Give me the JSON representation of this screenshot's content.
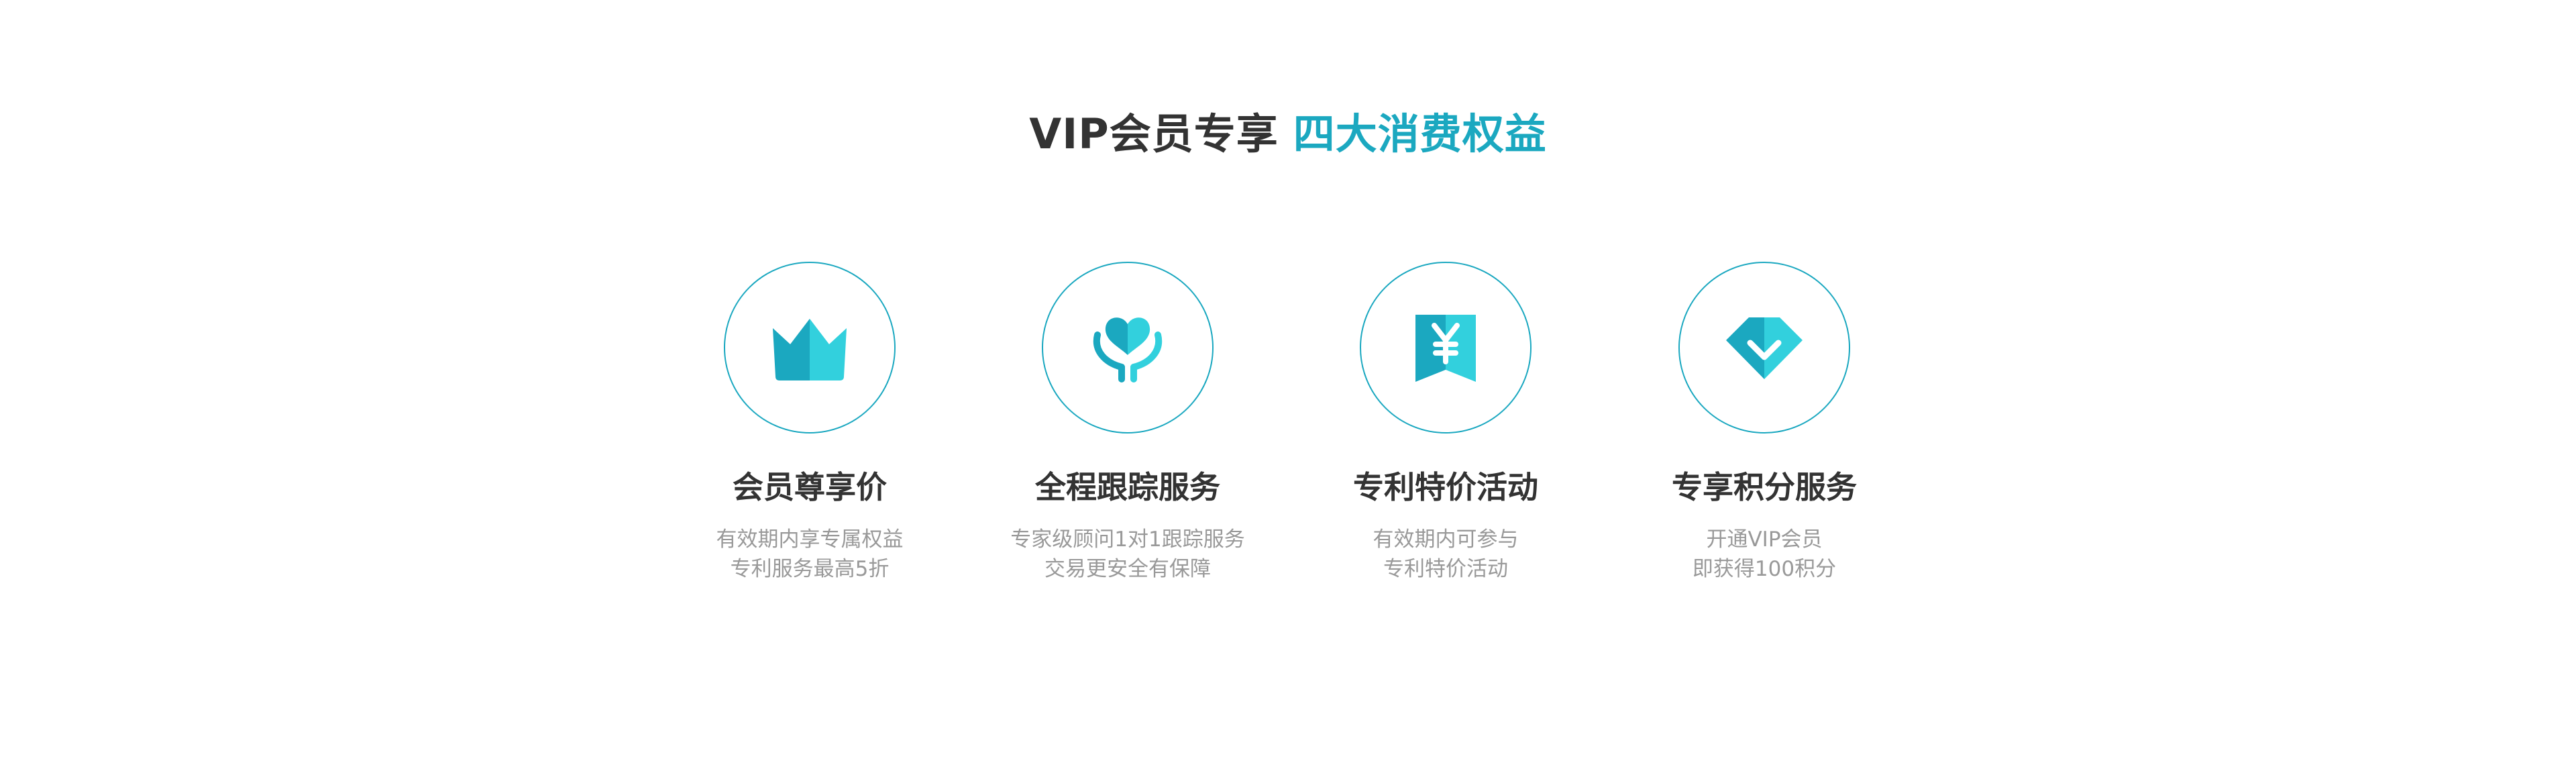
{
  "header": {
    "title_main": "VIP会员专享",
    "title_accent": "四大消费权益"
  },
  "colors": {
    "accent": "#1ba8c0",
    "accent_light": "#32d0dd",
    "title_text": "#333333",
    "desc_text": "#999999"
  },
  "benefits": [
    {
      "icon": "crown-icon",
      "title": "会员尊享价",
      "desc_line1": "有效期内享专属权益",
      "desc_line2": "专利服务最高5折"
    },
    {
      "icon": "heart-hands-icon",
      "title": "全程跟踪服务",
      "desc_line1": "专家级顾问1对1跟踪服务",
      "desc_line2": "交易更安全有保障"
    },
    {
      "icon": "yen-tag-icon",
      "title": "专利特价活动",
      "desc_line1": "有效期内可参与",
      "desc_line2": "专利特价活动"
    },
    {
      "icon": "diamond-icon",
      "title": "专享积分服务",
      "desc_line1": "开通VIP会员",
      "desc_line2": "即获得100积分"
    }
  ]
}
